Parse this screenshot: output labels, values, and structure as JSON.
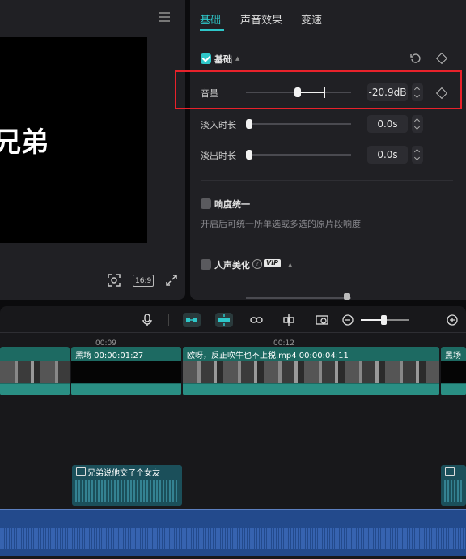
{
  "preview": {
    "subtitle": "兄弟",
    "ratio_label": "16:9"
  },
  "tabs": [
    "基础",
    "声音效果",
    "变速"
  ],
  "basic": {
    "section_label": "基础",
    "volume": {
      "label": "音量",
      "value": "-20.9dB"
    },
    "fade_in": {
      "label": "淡入时长",
      "value": "0.0s"
    },
    "fade_out": {
      "label": "淡出时长",
      "value": "0.0s"
    }
  },
  "loudness": {
    "label": "响度统一",
    "description": "开启后可统一所单选或多选的原片段响度"
  },
  "voice_beautify": {
    "label": "人声美化",
    "badge": "VIP"
  },
  "timeline": {
    "ruler": [
      "00:09",
      "00:12"
    ],
    "clips": [
      {
        "title": "黑场  00:00:01:27"
      },
      {
        "title": "欧呀，反正吹牛也不上税.mp4  00:00:04:11"
      },
      {
        "title": "黑场"
      }
    ],
    "subtitle_clip": "兄弟说他交了个女友"
  },
  "colors": {
    "accent": "#2ec7c9",
    "highlight": "#e8222b",
    "video_clip": "#1d6a62",
    "audio_track": "#234a8c"
  }
}
